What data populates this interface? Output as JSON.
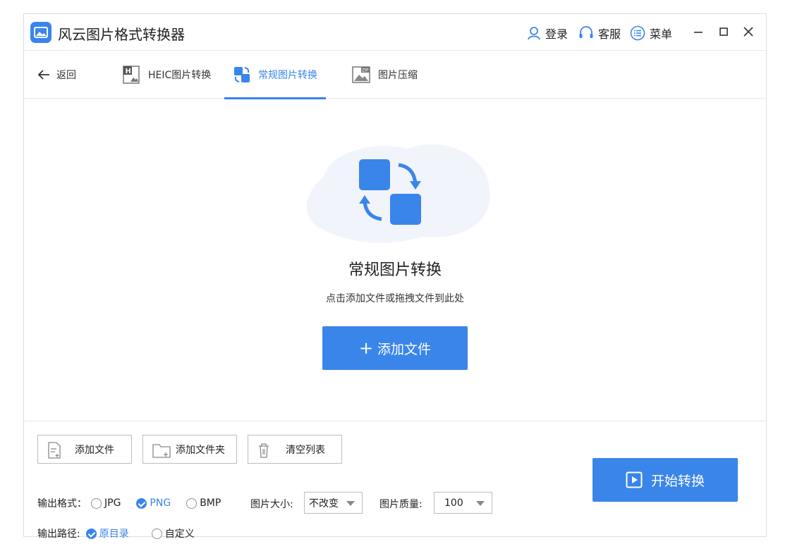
{
  "app": {
    "title": "风云图片格式转换器"
  },
  "titlebar": {
    "login": "登录",
    "service": "客服",
    "menu": "菜单"
  },
  "nav": {
    "back": "返回",
    "tabs": [
      {
        "label": "HEIC图片转换"
      },
      {
        "label": "常规图片转换"
      },
      {
        "label": "图片压缩"
      }
    ]
  },
  "drop": {
    "title": "常规图片转换",
    "hint": "点击添加文件或拖拽文件到此处",
    "add_button": "添加文件"
  },
  "toolbar": {
    "add_file": "添加文件",
    "add_folder": "添加文件夹",
    "clear_list": "清空列表"
  },
  "options": {
    "format_label": "输出格式：",
    "formats": [
      "JPG",
      "PNG",
      "BMP"
    ],
    "selected_format": "PNG",
    "size_label": "图片大小:",
    "size_value": "不改变",
    "quality_label": "图片质量:",
    "quality_value": "100",
    "path_label": "输出路径:",
    "paths": [
      "原目录",
      "自定义"
    ],
    "selected_path": "原目录"
  },
  "start_button": "开始转换",
  "colors": {
    "accent": "#3a85ea"
  }
}
